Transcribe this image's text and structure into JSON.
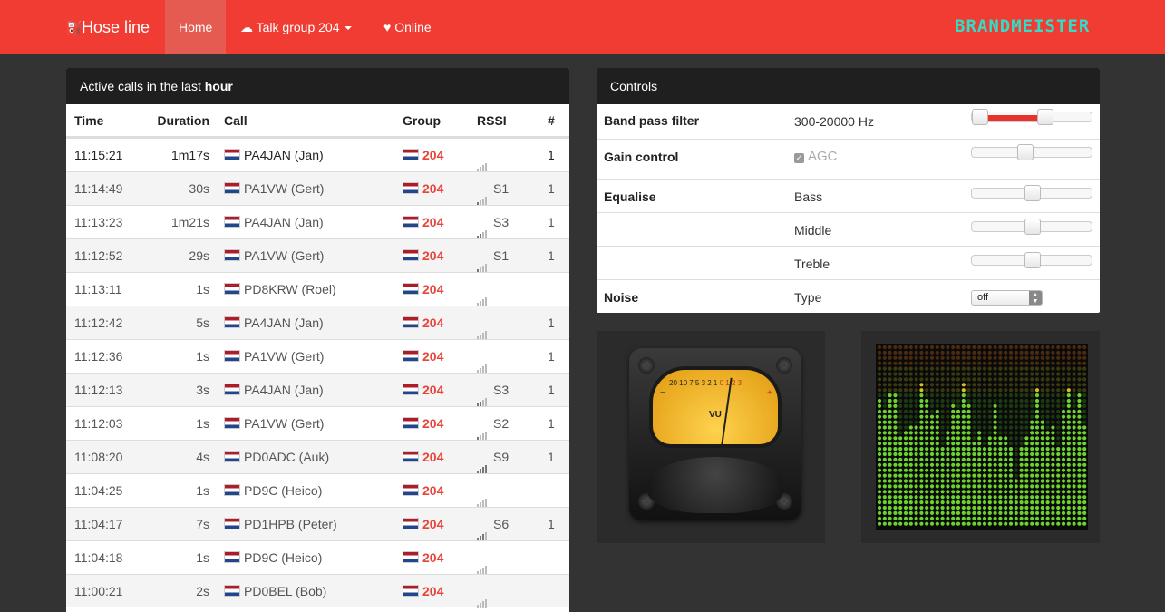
{
  "navbar": {
    "brand": "Hose line",
    "home": "Home",
    "talk_group": "Talk group 204",
    "online": "Online",
    "logo": "BRANDMEISTER"
  },
  "calls_panel": {
    "title_prefix": "Active calls in the last ",
    "title_bold": "hour",
    "columns": [
      "Time",
      "Duration",
      "Call",
      "Group",
      "RSSI",
      "#"
    ],
    "rows": [
      {
        "time": "11:15:21",
        "duration": "1m17s",
        "call": "PA4JAN (Jan)",
        "group": "204",
        "rssi": "",
        "count": "1",
        "bars": 0
      },
      {
        "time": "11:14:49",
        "duration": "30s",
        "call": "PA1VW (Gert)",
        "group": "204",
        "rssi": "S1",
        "count": "1",
        "bars": 1
      },
      {
        "time": "11:13:23",
        "duration": "1m21s",
        "call": "PA4JAN (Jan)",
        "group": "204",
        "rssi": "S3",
        "count": "1",
        "bars": 2
      },
      {
        "time": "11:12:52",
        "duration": "29s",
        "call": "PA1VW (Gert)",
        "group": "204",
        "rssi": "S1",
        "count": "1",
        "bars": 1
      },
      {
        "time": "11:13:11",
        "duration": "1s",
        "call": "PD8KRW (Roel)",
        "group": "204",
        "rssi": "",
        "count": "",
        "bars": 0
      },
      {
        "time": "11:12:42",
        "duration": "5s",
        "call": "PA4JAN (Jan)",
        "group": "204",
        "rssi": "",
        "count": "1",
        "bars": 0
      },
      {
        "time": "11:12:36",
        "duration": "1s",
        "call": "PA1VW (Gert)",
        "group": "204",
        "rssi": "",
        "count": "1",
        "bars": 0
      },
      {
        "time": "11:12:13",
        "duration": "3s",
        "call": "PA4JAN (Jan)",
        "group": "204",
        "rssi": "S3",
        "count": "1",
        "bars": 2
      },
      {
        "time": "11:12:03",
        "duration": "1s",
        "call": "PA1VW (Gert)",
        "group": "204",
        "rssi": "S2",
        "count": "1",
        "bars": 1
      },
      {
        "time": "11:08:20",
        "duration": "4s",
        "call": "PD0ADC (Auk)",
        "group": "204",
        "rssi": "S9",
        "count": "1",
        "bars": 4
      },
      {
        "time": "11:04:25",
        "duration": "1s",
        "call": "PD9C (Heico)",
        "group": "204",
        "rssi": "",
        "count": "",
        "bars": 0
      },
      {
        "time": "11:04:17",
        "duration": "7s",
        "call": "PD1HPB (Peter)",
        "group": "204",
        "rssi": "S6",
        "count": "1",
        "bars": 3
      },
      {
        "time": "11:04:18",
        "duration": "1s",
        "call": "PD9C (Heico)",
        "group": "204",
        "rssi": "",
        "count": "",
        "bars": 0
      },
      {
        "time": "11:00:21",
        "duration": "2s",
        "call": "PD0BEL (Bob)",
        "group": "204",
        "rssi": "",
        "count": "",
        "bars": 0
      }
    ]
  },
  "controls": {
    "title": "Controls",
    "band_pass_label": "Band pass filter",
    "band_pass_value": "300-20000 Hz",
    "band_pass_range": [
      0.0,
      0.62
    ],
    "gain_label": "Gain control",
    "agc_label": "AGC",
    "gain_level": 0.43,
    "equalise_label": "Equalise",
    "bass_label": "Bass",
    "bass_level": 0.5,
    "middle_label": "Middle",
    "middle_level": 0.5,
    "treble_label": "Treble",
    "treble_level": 0.5,
    "noise_label": "Noise",
    "type_label": "Type",
    "type_value": "off"
  },
  "vu_meter": {
    "label": "VU",
    "scale_black": "20 10 7 5 3 2 1",
    "scale_red": "0 1 2 3",
    "minus": "−",
    "plus": "+"
  },
  "colors": {
    "accent": "#f03c32",
    "logo": "#32dcc6",
    "group": "#e8443a"
  }
}
